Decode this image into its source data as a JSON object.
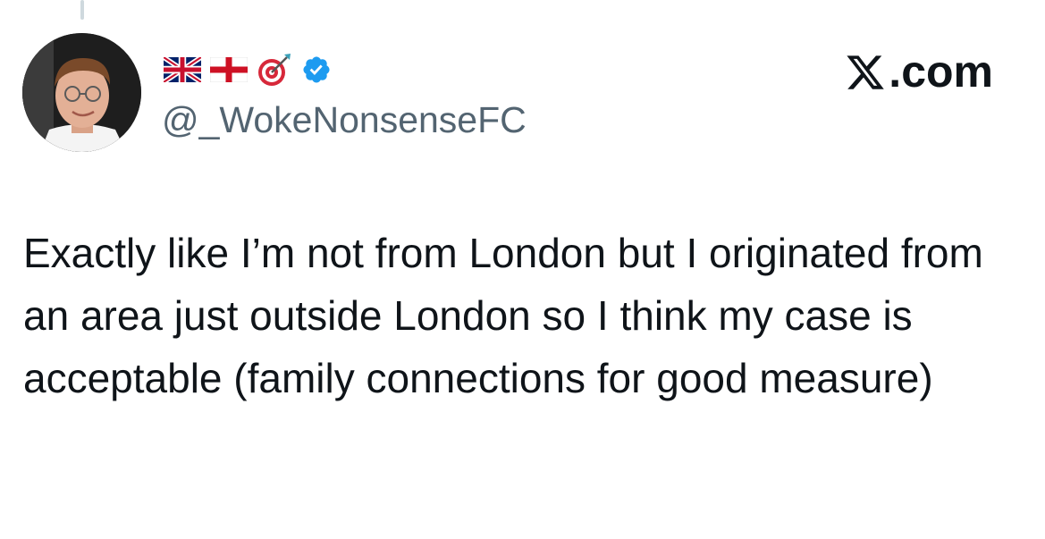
{
  "tweet": {
    "handle": "@_WokeNonsenseFC",
    "display_name_emojis": [
      "uk-flag-icon",
      "england-flag-icon",
      "direct-hit-target-icon"
    ],
    "verified": true,
    "text": "Exactly like I’m not from London but I originated from an area just outside London so I think my case is acceptable (family connections for good measure)"
  },
  "brand": {
    "label": ".com",
    "icon": "x-logo-icon"
  },
  "colors": {
    "text": "#0f1419",
    "secondary": "#536471",
    "verified_blue": "#1d9bf0",
    "thread_line": "#cfd9de"
  }
}
